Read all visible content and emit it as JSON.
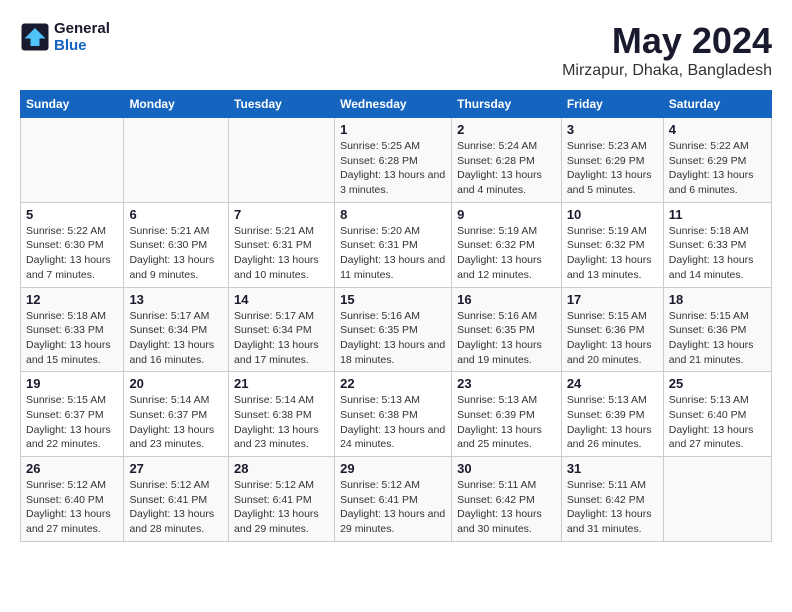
{
  "logo": {
    "line1": "General",
    "line2": "Blue"
  },
  "title": "May 2024",
  "subtitle": "Mirzapur, Dhaka, Bangladesh",
  "days_of_week": [
    "Sunday",
    "Monday",
    "Tuesday",
    "Wednesday",
    "Thursday",
    "Friday",
    "Saturday"
  ],
  "weeks": [
    [
      {
        "num": "",
        "info": ""
      },
      {
        "num": "",
        "info": ""
      },
      {
        "num": "",
        "info": ""
      },
      {
        "num": "1",
        "info": "Sunrise: 5:25 AM\nSunset: 6:28 PM\nDaylight: 13 hours and 3 minutes."
      },
      {
        "num": "2",
        "info": "Sunrise: 5:24 AM\nSunset: 6:28 PM\nDaylight: 13 hours and 4 minutes."
      },
      {
        "num": "3",
        "info": "Sunrise: 5:23 AM\nSunset: 6:29 PM\nDaylight: 13 hours and 5 minutes."
      },
      {
        "num": "4",
        "info": "Sunrise: 5:22 AM\nSunset: 6:29 PM\nDaylight: 13 hours and 6 minutes."
      }
    ],
    [
      {
        "num": "5",
        "info": "Sunrise: 5:22 AM\nSunset: 6:30 PM\nDaylight: 13 hours and 7 minutes."
      },
      {
        "num": "6",
        "info": "Sunrise: 5:21 AM\nSunset: 6:30 PM\nDaylight: 13 hours and 9 minutes."
      },
      {
        "num": "7",
        "info": "Sunrise: 5:21 AM\nSunset: 6:31 PM\nDaylight: 13 hours and 10 minutes."
      },
      {
        "num": "8",
        "info": "Sunrise: 5:20 AM\nSunset: 6:31 PM\nDaylight: 13 hours and 11 minutes."
      },
      {
        "num": "9",
        "info": "Sunrise: 5:19 AM\nSunset: 6:32 PM\nDaylight: 13 hours and 12 minutes."
      },
      {
        "num": "10",
        "info": "Sunrise: 5:19 AM\nSunset: 6:32 PM\nDaylight: 13 hours and 13 minutes."
      },
      {
        "num": "11",
        "info": "Sunrise: 5:18 AM\nSunset: 6:33 PM\nDaylight: 13 hours and 14 minutes."
      }
    ],
    [
      {
        "num": "12",
        "info": "Sunrise: 5:18 AM\nSunset: 6:33 PM\nDaylight: 13 hours and 15 minutes."
      },
      {
        "num": "13",
        "info": "Sunrise: 5:17 AM\nSunset: 6:34 PM\nDaylight: 13 hours and 16 minutes."
      },
      {
        "num": "14",
        "info": "Sunrise: 5:17 AM\nSunset: 6:34 PM\nDaylight: 13 hours and 17 minutes."
      },
      {
        "num": "15",
        "info": "Sunrise: 5:16 AM\nSunset: 6:35 PM\nDaylight: 13 hours and 18 minutes."
      },
      {
        "num": "16",
        "info": "Sunrise: 5:16 AM\nSunset: 6:35 PM\nDaylight: 13 hours and 19 minutes."
      },
      {
        "num": "17",
        "info": "Sunrise: 5:15 AM\nSunset: 6:36 PM\nDaylight: 13 hours and 20 minutes."
      },
      {
        "num": "18",
        "info": "Sunrise: 5:15 AM\nSunset: 6:36 PM\nDaylight: 13 hours and 21 minutes."
      }
    ],
    [
      {
        "num": "19",
        "info": "Sunrise: 5:15 AM\nSunset: 6:37 PM\nDaylight: 13 hours and 22 minutes."
      },
      {
        "num": "20",
        "info": "Sunrise: 5:14 AM\nSunset: 6:37 PM\nDaylight: 13 hours and 23 minutes."
      },
      {
        "num": "21",
        "info": "Sunrise: 5:14 AM\nSunset: 6:38 PM\nDaylight: 13 hours and 23 minutes."
      },
      {
        "num": "22",
        "info": "Sunrise: 5:13 AM\nSunset: 6:38 PM\nDaylight: 13 hours and 24 minutes."
      },
      {
        "num": "23",
        "info": "Sunrise: 5:13 AM\nSunset: 6:39 PM\nDaylight: 13 hours and 25 minutes."
      },
      {
        "num": "24",
        "info": "Sunrise: 5:13 AM\nSunset: 6:39 PM\nDaylight: 13 hours and 26 minutes."
      },
      {
        "num": "25",
        "info": "Sunrise: 5:13 AM\nSunset: 6:40 PM\nDaylight: 13 hours and 27 minutes."
      }
    ],
    [
      {
        "num": "26",
        "info": "Sunrise: 5:12 AM\nSunset: 6:40 PM\nDaylight: 13 hours and 27 minutes."
      },
      {
        "num": "27",
        "info": "Sunrise: 5:12 AM\nSunset: 6:41 PM\nDaylight: 13 hours and 28 minutes."
      },
      {
        "num": "28",
        "info": "Sunrise: 5:12 AM\nSunset: 6:41 PM\nDaylight: 13 hours and 29 minutes."
      },
      {
        "num": "29",
        "info": "Sunrise: 5:12 AM\nSunset: 6:41 PM\nDaylight: 13 hours and 29 minutes."
      },
      {
        "num": "30",
        "info": "Sunrise: 5:11 AM\nSunset: 6:42 PM\nDaylight: 13 hours and 30 minutes."
      },
      {
        "num": "31",
        "info": "Sunrise: 5:11 AM\nSunset: 6:42 PM\nDaylight: 13 hours and 31 minutes."
      },
      {
        "num": "",
        "info": ""
      }
    ]
  ]
}
